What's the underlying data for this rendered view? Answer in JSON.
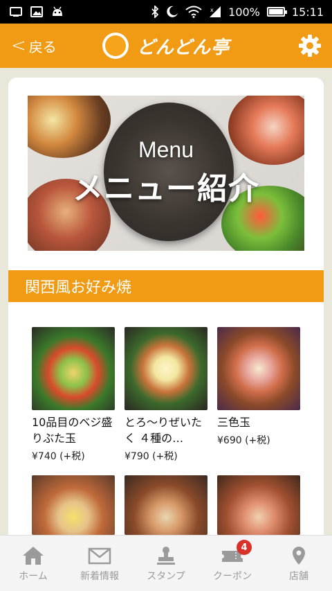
{
  "status_bar": {
    "battery": "100%",
    "time": "15:11",
    "icons": [
      "usb-icon",
      "image-icon",
      "android-icon",
      "bluetooth-icon",
      "moon-icon",
      "wifi-icon",
      "signal-icon",
      "battery-icon"
    ]
  },
  "header": {
    "back_label": "戻る",
    "logo_text": "どんどん亭",
    "settings_icon": "gear-icon",
    "color": "#f19a14"
  },
  "banner": {
    "title": "Menu",
    "subtitle": "メニュー紹介"
  },
  "section": {
    "title": "関西風お好み焼"
  },
  "menu_items": [
    {
      "name": "10品目のベジ盛りぶた玉",
      "price": "¥740 (+税)"
    },
    {
      "name": "とろ～りぜいたく ４種の…",
      "price": "¥790 (+税)"
    },
    {
      "name": "三色玉",
      "price": "¥690 (+税)"
    },
    {
      "name": "",
      "price": ""
    },
    {
      "name": "",
      "price": ""
    },
    {
      "name": "",
      "price": ""
    }
  ],
  "tabs": [
    {
      "label": "ホーム",
      "icon": "home-icon"
    },
    {
      "label": "新着情報",
      "icon": "mail-icon"
    },
    {
      "label": "スタンプ",
      "icon": "stamp-icon"
    },
    {
      "label": "クーポン",
      "icon": "coupon-icon",
      "badge": "4"
    },
    {
      "label": "店舗",
      "icon": "location-pin-icon"
    }
  ],
  "colors": {
    "accent": "#f19a14",
    "background": "#e9e6da",
    "badge": "#d9302a"
  }
}
